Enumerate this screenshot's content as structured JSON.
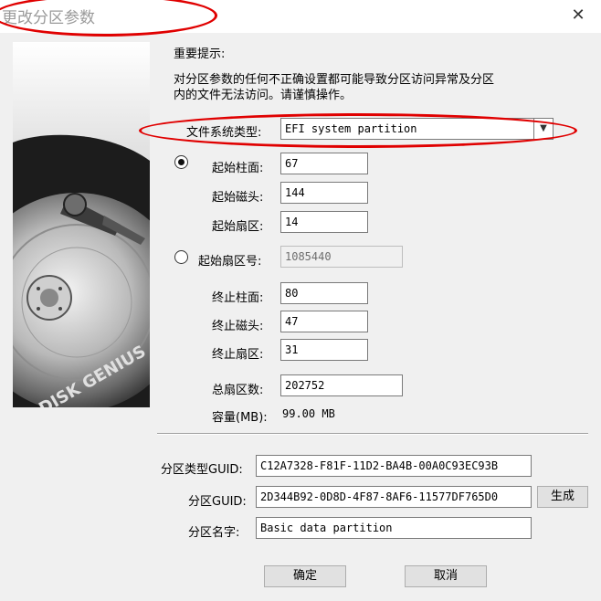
{
  "window": {
    "title": "更改分区参数",
    "close_glyph": "✕"
  },
  "notice": {
    "heading": "重要提示:",
    "line1": "对分区参数的任何不正确设置都可能导致分区访问异常及分区",
    "line2": "内的文件无法访问。请谨慎操作。"
  },
  "fs_type": {
    "label": "文件系统类型:",
    "value": "EFI system partition"
  },
  "start_chs": {
    "cylinder_label": "起始柱面:",
    "cylinder": "67",
    "head_label": "起始磁头:",
    "head": "144",
    "sector_label": "起始扇区:",
    "sector": "14"
  },
  "start_lba": {
    "label": "起始扇区号:",
    "value": "1085440"
  },
  "end_chs": {
    "cylinder_label": "终止柱面:",
    "cylinder": "80",
    "head_label": "终止磁头:",
    "head": "47",
    "sector_label": "终止扇区:",
    "sector": "31"
  },
  "total_sectors": {
    "label": "总扇区数:",
    "value": "202752"
  },
  "capacity": {
    "label": "容量(MB):",
    "value": "99.00 MB"
  },
  "guid": {
    "type_label": "分区类型GUID:",
    "type_value": "C12A7328-F81F-11D2-BA4B-00A0C93EC93B",
    "part_label": "分区GUID:",
    "part_value": "2D344B92-0D8D-4F87-8AF6-11577DF765D0",
    "generate_label": "生成",
    "name_label": "分区名字:",
    "name_value": "Basic data partition"
  },
  "buttons": {
    "ok": "确定",
    "cancel": "取消"
  },
  "logo": {
    "text": "DISK GENIUS"
  },
  "colors": {
    "annotation": "#e00000",
    "title_text": "#9a9a9a"
  }
}
